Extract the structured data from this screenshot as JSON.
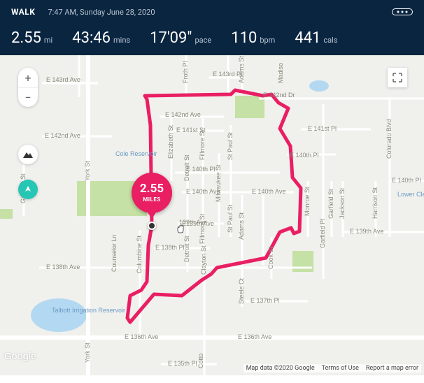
{
  "header": {
    "activity_type": "WALK",
    "timestamp": "7:47 AM, Sunday June 28, 2020"
  },
  "stats": {
    "distance": {
      "value": "2.55",
      "unit": "mi"
    },
    "duration": {
      "value": "43:46",
      "unit": "mins"
    },
    "pace": {
      "value": "17'09\"",
      "unit": "pace"
    },
    "hr": {
      "value": "110",
      "unit": "bpm"
    },
    "calories": {
      "value": "441",
      "unit": "cals"
    }
  },
  "badge": {
    "value": "2.55",
    "unit": "MILES"
  },
  "map_labels": {
    "cole_reservoir": "Cole Reservoir",
    "talbott": "Talbott Irrigation Reservoir",
    "lower_clear": "Lower Clear Creek Reservoir",
    "e143rd_ave": "E 143rd Ave",
    "e143rd_pl": "E 143rd Pl",
    "e142nd_dr": "E 142nd Dr",
    "e142nd_ave": "E 142nd Ave",
    "e141st_st": "E 141st St",
    "e141st_pl": "E 141st Pl",
    "e140th_pl": "E 140th Pl",
    "e140th_pl2": "E 140th Pl",
    "e140th_pl3": "E 140th Pl",
    "e140th_ave": "E 140th Ave",
    "e139th_ave": "139th Ave",
    "e139th_ave2": "E139th Ave",
    "e139th_ave3": "E 139th Ave",
    "e138th_ave": "E 138th Ave",
    "e138th_pl": "E 138th Pl",
    "e137th_pl": "E 137th Pl",
    "e136th_ave": "E 136th Ave",
    "e136th_ave2": "E 136th Ave",
    "e135th_pl": "E 135th Pl",
    "york_st": "York St",
    "york_st2": "York St",
    "gaylord_st": "Gaylord St",
    "columbine_st": "Columbine St",
    "elizabeth_st": "Elizabeth St",
    "detroit_st": "Detroit St",
    "detroit_st2": "Detroit St",
    "fillmore_st": "Fillmore St",
    "fillmore_st2": "Fillmore St",
    "milwaukee_st": "Milwaukee St",
    "st_paul_st": "St Paul St",
    "st_paul_st2": "St Paul St",
    "adams_st": "Adams St",
    "adams_st2": "Adams St",
    "cook_st": "Cook St",
    "clayton_st": "Clayton St",
    "steele_ct": "Steele Ct",
    "monroe_st": "Monroe St",
    "garfield_st": "Garfield St",
    "garfield_pl": "Garfield Pl",
    "jackson_st": "Jackson St",
    "harrison_st": "Harrison St",
    "colorado_blvd": "Colorado Blvd",
    "cottonwood": "Cotto",
    "madison": "Madiso",
    "counselor": "Counselor Ln",
    "froth": "Froth Pl"
  },
  "attribution": {
    "map_data": "Map data ©2020 Google",
    "terms": "Terms of Use",
    "report": "Report a map error"
  },
  "google": "Google",
  "controls": {
    "zoom_in": "+",
    "zoom_out": "−"
  }
}
